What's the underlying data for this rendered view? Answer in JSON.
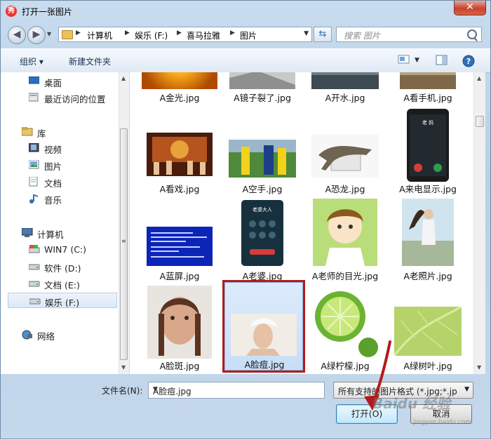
{
  "window": {
    "title": "打开一张图片",
    "app_icon_char": "秀",
    "close_label": "✕"
  },
  "address_bar": {
    "crumbs": [
      "计算机",
      "娱乐 (F:)",
      "喜马拉雅",
      "图片"
    ],
    "search_placeholder": "搜索 图片"
  },
  "toolbar": {
    "organize_label": "组织 ▾",
    "new_folder_label": "新建文件夹"
  },
  "sidebar": {
    "items": [
      {
        "label": "桌面",
        "icon": "desktop-icon"
      },
      {
        "label": "最近访问的位置",
        "icon": "recent-places-icon"
      },
      {
        "label": "库",
        "icon": "library-icon"
      },
      {
        "label": "视频",
        "icon": "video-library-icon"
      },
      {
        "label": "图片",
        "icon": "pictures-library-icon"
      },
      {
        "label": "文档",
        "icon": "documents-library-icon"
      },
      {
        "label": "音乐",
        "icon": "music-library-icon"
      },
      {
        "label": "计算机",
        "icon": "computer-icon"
      },
      {
        "label": "WIN7 (C:)",
        "icon": "system-drive-icon"
      },
      {
        "label": "软件 (D:)",
        "icon": "drive-icon"
      },
      {
        "label": "文档 (E:)",
        "icon": "drive-icon"
      },
      {
        "label": "娱乐 (F:)",
        "icon": "drive-icon"
      },
      {
        "label": "网络",
        "icon": "network-icon"
      }
    ]
  },
  "files": [
    {
      "name": "A金光.jpg",
      "selected": false
    },
    {
      "name": "A镜子裂了.jpg",
      "selected": false
    },
    {
      "name": "A开水.jpg",
      "selected": false
    },
    {
      "name": "A看手机.jpg",
      "selected": false
    },
    {
      "name": "A看戏.jpg",
      "selected": false
    },
    {
      "name": "A空手.jpg",
      "selected": false
    },
    {
      "name": "A恐龙.jpg",
      "selected": false
    },
    {
      "name": "A来电显示.jpg",
      "selected": false
    },
    {
      "name": "A蓝屏.jpg",
      "selected": false
    },
    {
      "name": "A老婆.jpg",
      "selected": false
    },
    {
      "name": "A老师的目光.jpg",
      "selected": false
    },
    {
      "name": "A老照片.jpg",
      "selected": false
    },
    {
      "name": "A脸斑.jpg",
      "selected": false
    },
    {
      "name": "A脸痘.jpg",
      "selected": true
    },
    {
      "name": "A绿柠檬.jpg",
      "selected": false
    },
    {
      "name": "A绿树叶.jpg",
      "selected": false
    }
  ],
  "phone_screen": {
    "caller": "老 妈",
    "wife_caller": "老婆大人"
  },
  "footer": {
    "filename_label": "文件名(N):",
    "filename_value": "A脸痘.jpg",
    "filter_value": "所有支持的图片格式 (*.jpg;*.jp",
    "open_label": "打开(O)",
    "cancel_label": "取消"
  },
  "watermark": {
    "text": "Baidu 经验",
    "url": "jingyan.baidu.com"
  },
  "colors": {
    "highlight_box": "#b31b1b",
    "arrow": "#b31b1b",
    "selection": "#c7def7"
  }
}
